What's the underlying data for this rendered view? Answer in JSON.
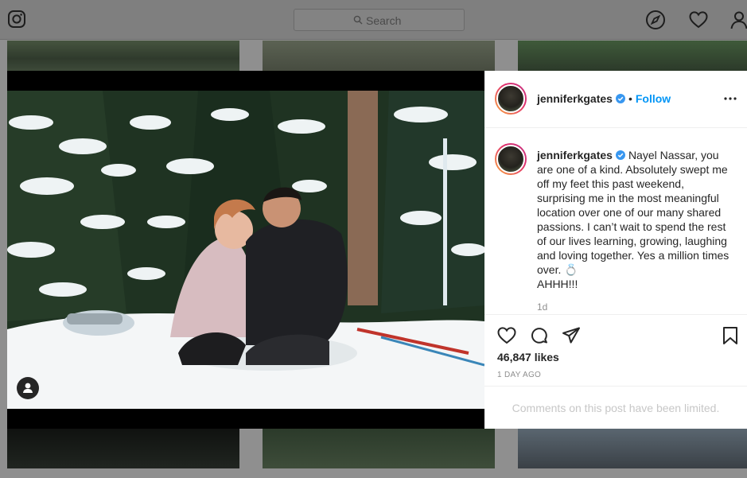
{
  "nav": {
    "search_placeholder": "Search",
    "icons": [
      "instagram-logo-icon",
      "search-icon",
      "explore-compass-icon",
      "activity-heart-icon",
      "profile-icon"
    ]
  },
  "post": {
    "username": "jenniferkgates",
    "follow_label": "Follow",
    "separator": "•",
    "caption": "Nayel Nassar, you are one of a kind. Absolutely swept me off my feet this past weekend, surprising me in the most meaningful location over one of our many shared passions. I can’t wait to spend the rest of our lives learning, growing, laughing and loving together. Yes a million times over. 💍",
    "caption_end": "AHHH!!!",
    "caption_age": "1d",
    "likes": "46,847 likes",
    "date": "1 DAY AGO",
    "comments_notice": "Comments on this post have been limited."
  },
  "colors": {
    "accent": "#0095f6",
    "verified": "#3897f0",
    "overlay": "#8f8f8f"
  }
}
